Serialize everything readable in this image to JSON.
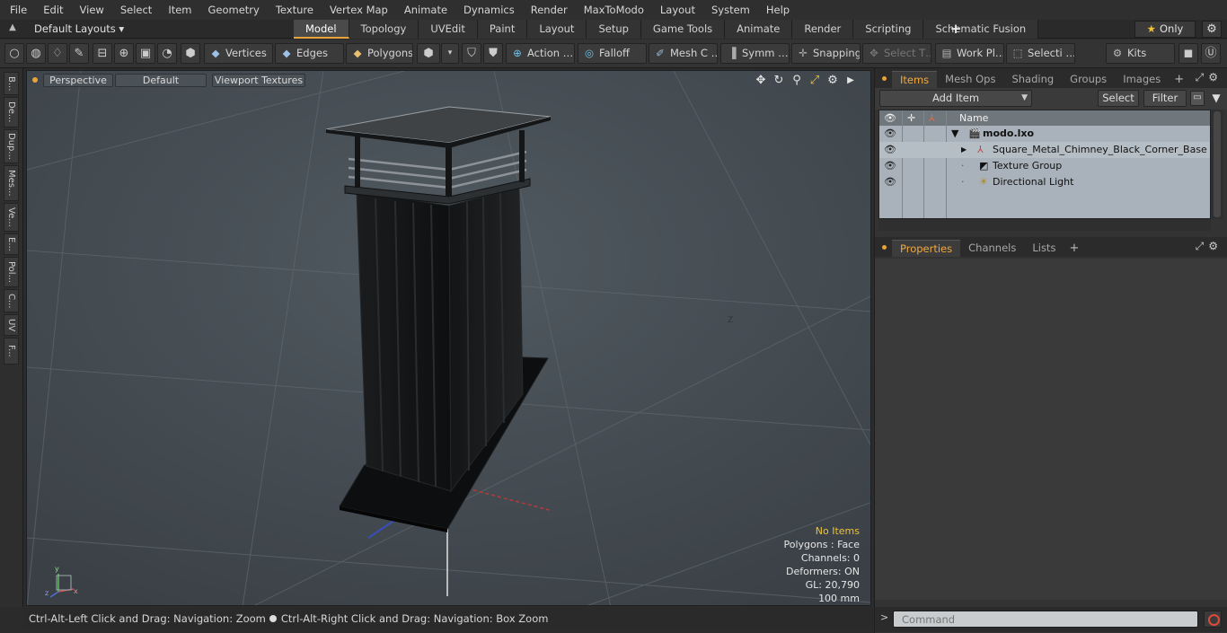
{
  "menu": [
    "File",
    "Edit",
    "View",
    "Select",
    "Item",
    "Geometry",
    "Texture",
    "Vertex Map",
    "Animate",
    "Dynamics",
    "Render",
    "MaxToModo",
    "Layout",
    "System",
    "Help"
  ],
  "layout_dropdown": "Default Layouts ▾",
  "tabs": [
    "Model",
    "Topology",
    "UVEdit",
    "Paint",
    "Layout",
    "Setup",
    "Game Tools",
    "Animate",
    "Render",
    "Scripting",
    "Schematic Fusion"
  ],
  "active_tab": "Model",
  "tab_add": "+",
  "only_label": "Only",
  "toolbar": {
    "vertices": "Vertices",
    "edges": "Edges",
    "polygons": "Polygons",
    "action": "Action …",
    "falloff": "Falloff",
    "mesh": "Mesh C …",
    "symmetry": "Symm …",
    "snapping": "Snapping",
    "select_t": "Select T…",
    "work_plane": "Work Pl…",
    "selection": "Selecti …",
    "kits": "Kits"
  },
  "left_tabs": [
    "B...",
    "De...",
    "Dup...",
    "Mes...",
    "Ve...",
    "E...",
    "Pol...",
    "C...",
    "UV",
    "F..."
  ],
  "viewport": {
    "perspective": "Perspective",
    "default": "Default",
    "viewport_textures": "Viewport Textures",
    "info": {
      "no_items": "No Items",
      "polygons": "Polygons : Face",
      "channels": "Channels: 0",
      "deformers": "Deformers: ON",
      "gl": "GL: 20,790",
      "scale": "100 mm"
    },
    "axis_label_z": "Z"
  },
  "status": {
    "left": "Ctrl-Alt-Left Click and Drag: Navigation: Zoom",
    "right": "Ctrl-Alt-Right Click and Drag: Navigation: Box Zoom"
  },
  "items_panel": {
    "tabs": [
      "Items",
      "Mesh Ops",
      "Shading",
      "Groups",
      "Images"
    ],
    "active": "Items",
    "add_item": "Add Item",
    "select": "Select",
    "filter": "Filter",
    "column_name": "Name",
    "rows": [
      {
        "label": "modo.lxo",
        "bold": true
      },
      {
        "label": "Square_Metal_Chimney_Black_Corner_Base"
      },
      {
        "label": "Texture Group"
      },
      {
        "label": "Directional Light"
      }
    ]
  },
  "properties_panel": {
    "tabs": [
      "Properties",
      "Channels",
      "Lists"
    ],
    "active": "Properties"
  },
  "command": {
    "placeholder": "Command"
  }
}
